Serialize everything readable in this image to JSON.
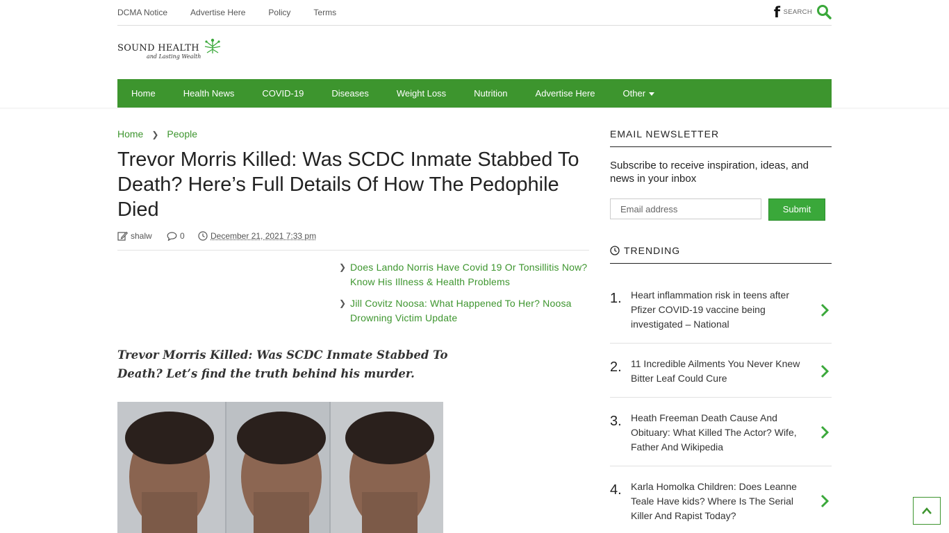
{
  "topbar": {
    "links": [
      "DCMA Notice",
      "Advertise Here",
      "Policy",
      "Terms"
    ],
    "facebook_icon": "f",
    "search_label": "SEARCH"
  },
  "logo": {
    "line1": "SOUND HEALTH",
    "line2": "and Lasting Wealth"
  },
  "nav": {
    "items": [
      "Home",
      "Health News",
      "COVID-19",
      "Diseases",
      "Weight Loss",
      "Nutrition",
      "Advertise Here",
      "Other"
    ],
    "accent": "#3d952e"
  },
  "breadcrumb": [
    "Home",
    "People"
  ],
  "article": {
    "title": "Trevor Morris Killed: Was SCDC Inmate Stabbed To Death? Here’s Full Details Of How The Pedophile Died",
    "author": "shalw",
    "comments": "0",
    "date": "December 21, 2021 7:33 pm",
    "related": [
      " Does Lando Norris Have Covid 19 Or Tonsillitis Now? Know His Illness & Health Problems",
      "Jill Covitz Noosa: What Happened To Her? Noosa Drowning Victim Update"
    ],
    "lead": "Trevor Morris Killed: Was SCDC Inmate Stabbed To Death? Let’s find the truth behind his murder."
  },
  "newsletter": {
    "heading": "EMAIL NEWSLETTER",
    "text": "Subscribe to receive inspiration, ideas, and news in your inbox",
    "placeholder": "Email address",
    "submit": "Submit"
  },
  "trending": {
    "heading": "TRENDING",
    "items": [
      {
        "num": "1.",
        "text": "Heart inflammation risk in teens after Pfizer COVID-19 vaccine being investigated – National"
      },
      {
        "num": "2.",
        "text": "11 Incredible Ailments You Never Knew Bitter Leaf Could Cure"
      },
      {
        "num": "3.",
        "text": "Heath Freeman Death Cause And Obituary: What Killed The Actor? Wife, Father And Wikipedia"
      },
      {
        "num": "4.",
        "text": "Karla Homolka Children: Does Leanne Teale Have kids? Where Is The Serial Killer And Rapist Today?"
      }
    ]
  }
}
